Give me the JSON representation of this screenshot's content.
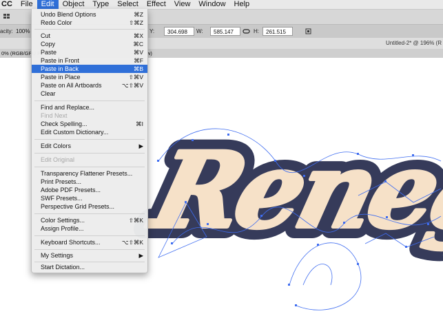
{
  "menubar": {
    "app": "CC",
    "items": [
      "File",
      "Edit",
      "Object",
      "Type",
      "Select",
      "Effect",
      "View",
      "Window",
      "Help"
    ]
  },
  "toolbar": {
    "opacity_label": "acity:",
    "opacity_value": "100%",
    "y_label": "Y:",
    "y_value": "304.698 px",
    "w_label": "W:",
    "w_value": "585.147 px",
    "h_label": "H:",
    "h_value": "261.515 px"
  },
  "document": {
    "title": "Untitled-2* @ 196% (R",
    "tab_label": "0% (RGB/GPU P",
    "tab_suffix": "w)"
  },
  "artwork": {
    "text": "Renegade",
    "fill": "#f6e1c8",
    "shadow": "#363b5a",
    "path_color": "#3f6df0"
  },
  "menu": {
    "items": [
      {
        "label": "Undo Blend Options",
        "shortcut": "⌘Z"
      },
      {
        "label": "Redo Color",
        "shortcut": "⇧⌘Z"
      },
      {
        "label": "Cut",
        "shortcut": "⌘X"
      },
      {
        "label": "Copy",
        "shortcut": "⌘C"
      },
      {
        "label": "Paste",
        "shortcut": "⌘V"
      },
      {
        "label": "Paste in Front",
        "shortcut": "⌘F"
      },
      {
        "label": "Paste in Back",
        "shortcut": "⌘B"
      },
      {
        "label": "Paste in Place",
        "shortcut": "⇧⌘V"
      },
      {
        "label": "Paste on All Artboards",
        "shortcut": "⌥⇧⌘V"
      },
      {
        "label": "Clear",
        "shortcut": ""
      },
      {
        "label": "Find and Replace...",
        "shortcut": ""
      },
      {
        "label": "Find Next",
        "shortcut": ""
      },
      {
        "label": "Check Spelling...",
        "shortcut": "⌘I"
      },
      {
        "label": "Edit Custom Dictionary...",
        "shortcut": ""
      },
      {
        "label": "Edit Colors",
        "shortcut": "▶"
      },
      {
        "label": "Edit Original",
        "shortcut": ""
      },
      {
        "label": "Transparency Flattener Presets...",
        "shortcut": ""
      },
      {
        "label": "Print Presets...",
        "shortcut": ""
      },
      {
        "label": "Adobe PDF Presets...",
        "shortcut": ""
      },
      {
        "label": "SWF Presets...",
        "shortcut": ""
      },
      {
        "label": "Perspective Grid Presets...",
        "shortcut": ""
      },
      {
        "label": "Color Settings...",
        "shortcut": "⇧⌘K"
      },
      {
        "label": "Assign Profile...",
        "shortcut": ""
      },
      {
        "label": "Keyboard Shortcuts...",
        "shortcut": "⌥⇧⌘K"
      },
      {
        "label": "My Settings",
        "shortcut": "▶"
      },
      {
        "label": "Start Dictation...",
        "shortcut": ""
      }
    ]
  }
}
